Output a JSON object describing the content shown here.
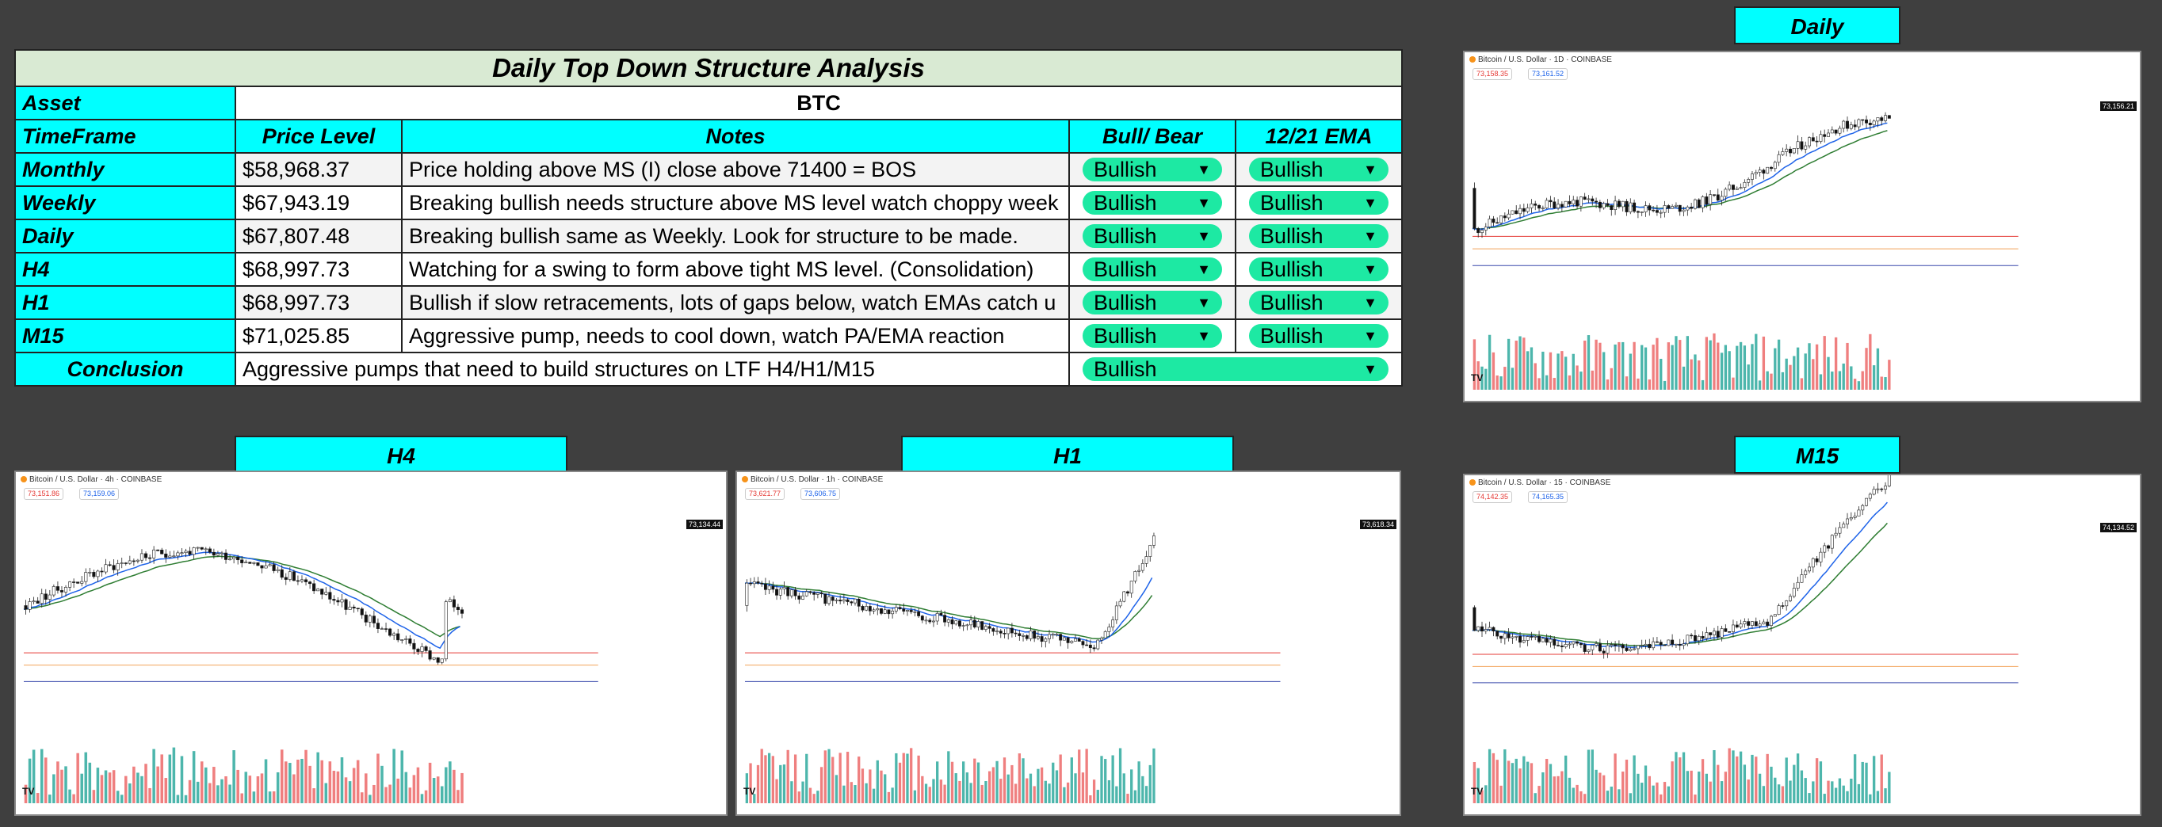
{
  "table": {
    "title": "Daily Top Down Structure Analysis",
    "asset_label": "Asset",
    "asset_value": "BTC",
    "headers": {
      "timeframe": "TimeFrame",
      "price_level": "Price Level",
      "notes": "Notes",
      "bull_bear": "Bull/ Bear",
      "ema": "12/21 EMA"
    },
    "rows": [
      {
        "timeframe": "Monthly",
        "price": "$58,968.37",
        "notes": "Price holding above MS (I) close above 71400 = BOS",
        "bull_bear": "Bullish",
        "ema": "Bullish"
      },
      {
        "timeframe": "Weekly",
        "price": "$67,943.19",
        "notes": "Breaking bullish needs structure above MS level watch choppy week",
        "bull_bear": "Bullish",
        "ema": "Bullish"
      },
      {
        "timeframe": "Daily",
        "price": "$67,807.48",
        "notes": "Breaking bullish same as Weekly. Look for structure to be made.",
        "bull_bear": "Bullish",
        "ema": "Bullish"
      },
      {
        "timeframe": "H4",
        "price": "$68,997.73",
        "notes": "Watching for a swing to form above tight MS level. (Consolidation)",
        "bull_bear": "Bullish",
        "ema": "Bullish"
      },
      {
        "timeframe": "H1",
        "price": "$68,997.73",
        "notes": "Bullish if slow retracements, lots of gaps below, watch EMAs catch u",
        "bull_bear": "Bullish",
        "ema": "Bullish"
      },
      {
        "timeframe": "M15",
        "price": "$71,025.85",
        "notes": "Aggressive pump, needs to cool down, watch PA/EMA reaction",
        "bull_bear": "Bullish",
        "ema": "Bullish"
      }
    ],
    "conclusion_label": "Conclusion",
    "conclusion_text": "Aggressive pumps that need to build structures on LTF H4/H1/M15",
    "conclusion_value": "Bullish"
  },
  "charts": {
    "daily": {
      "header": "Daily",
      "symbol": "Bitcoin / U.S. Dollar · 1D · COINBASE",
      "sell": "73,158.35",
      "buy": "73,161.52",
      "price_tag": "73,156.21"
    },
    "h4": {
      "header": "H4",
      "symbol": "Bitcoin / U.S. Dollar · 4h · COINBASE",
      "sell": "73,151.86",
      "buy": "73,159.06",
      "price_tag": "73,134.44"
    },
    "h1": {
      "header": "H1",
      "symbol": "Bitcoin / U.S. Dollar · 1h · COINBASE",
      "sell": "73,621.77",
      "buy": "73,606.75",
      "price_tag": "73,618.34"
    },
    "m15": {
      "header": "M15",
      "symbol": "Bitcoin / U.S. Dollar · 15 · COINBASE",
      "sell": "74,142.35",
      "buy": "74,165.35",
      "price_tag": "74,134.52"
    }
  },
  "colors": {
    "cyan": "#00ffff",
    "chip": "#1de9a3",
    "title_bg": "#d9ead3"
  },
  "icons": {
    "dropdown": "caret-down-icon",
    "tradingview": "tradingview-logo-icon"
  }
}
